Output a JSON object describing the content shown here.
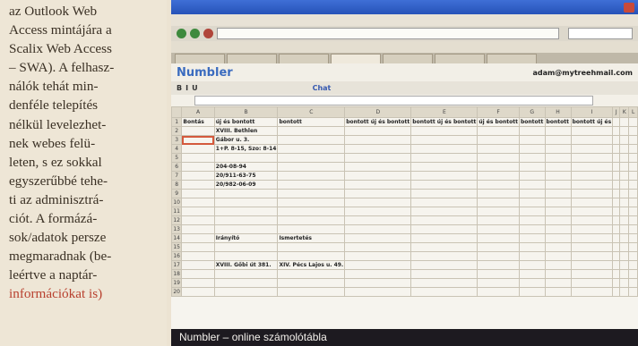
{
  "article": {
    "lines": [
      "az Outlook Web",
      "Access mintájára a",
      "Scalix Web Access",
      "– SWA). A felhasz-",
      "nálók tehát min-",
      "denféle telepítés",
      "nélkül levelezhet-",
      "nek webes felü-",
      "leten, s ez sokkal",
      "egyszerűbbé tehe-",
      "ti az adminisztrá-",
      "ciót. A formázá-",
      "sok/adatok persze",
      "megmaradnak (be-",
      "leértve a naptár-",
      "információkat is)"
    ]
  },
  "screenshot": {
    "app_logo": "Numbler",
    "account": "adam@mytreehmail.com",
    "toolbar_chat": "Chat",
    "columns": [
      "A",
      "B",
      "C",
      "D",
      "E",
      "F",
      "G",
      "H",
      "I",
      "J",
      "K",
      "L"
    ],
    "row_numbers": [
      "1",
      "2",
      "3",
      "4",
      "5",
      "6",
      "7",
      "8",
      "9",
      "10",
      "11",
      "12",
      "13",
      "14",
      "15",
      "16",
      "17",
      "18",
      "19",
      "20"
    ],
    "cells": {
      "a1": "Bontás",
      "b1": "új és bontott",
      "b2": "XVIII. Bethlen",
      "b2b": "Gábor u. 3.",
      "b3": "1+P. 8-15, Szo: 8-14",
      "b5": "204-08-94",
      "b6": "20/911-63-75",
      "b7": "20/982-06-09",
      "b11": "Irányító",
      "c11": "Ismertetés",
      "b13": "XVIII. Gőbi út 381.",
      "c13": "XIV. Pécs Lajos u. 49."
    },
    "headline_cols": [
      "bontott",
      "bontott új és bontott",
      "bontott új és bontott",
      "új és bontott",
      "bontott",
      "bontott",
      "bontott új és"
    ]
  },
  "caption": "Numbler – online számolótábla",
  "colors": {
    "caption_bg": "#1d1a20",
    "selection": "#d4593c",
    "link": "#3558b0"
  }
}
